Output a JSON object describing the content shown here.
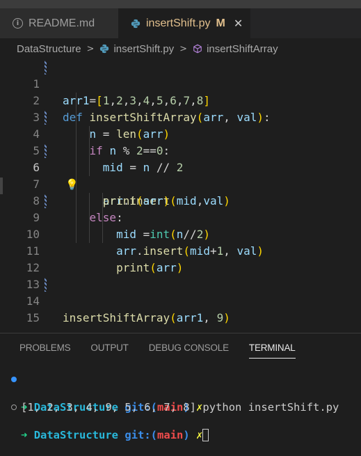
{
  "tabs": [
    {
      "label": "README.md",
      "icon": "info-icon"
    },
    {
      "label": "insertShift.py",
      "icon": "python-icon",
      "modified": "M",
      "close": "✕"
    }
  ],
  "breadcrumb": {
    "folder": "DataStructure",
    "file": "insertShift.py",
    "symbol": "insertShiftArray"
  },
  "editor": {
    "current_line": 6,
    "line_numbers": [
      "1",
      "2",
      "3",
      "4",
      "5",
      "6",
      "7",
      "8",
      "9",
      "10",
      "11",
      "12",
      "13",
      "14",
      "15"
    ]
  },
  "panel": {
    "tabs": [
      "PROBLEMS",
      "OUTPUT",
      "DEBUG CONSOLE",
      "TERMINAL"
    ],
    "active_tab": "TERMINAL"
  },
  "terminal": {
    "prompt_dir": "DataStructure",
    "git_label": "git:(",
    "branch": "main",
    "git_close": ")",
    "dirty_mark": "✗",
    "command": "python insertShift.py",
    "output": "[1, 2, 3, 4, 9, 5, 6, 7, 8]",
    "arrow": "➜"
  },
  "colors": {
    "editor_bg": "#1e1e1e",
    "keyword": "#569cd6",
    "control": "#c586c0",
    "function": "#dcdcaa",
    "terminal_green": "#23d18b"
  }
}
